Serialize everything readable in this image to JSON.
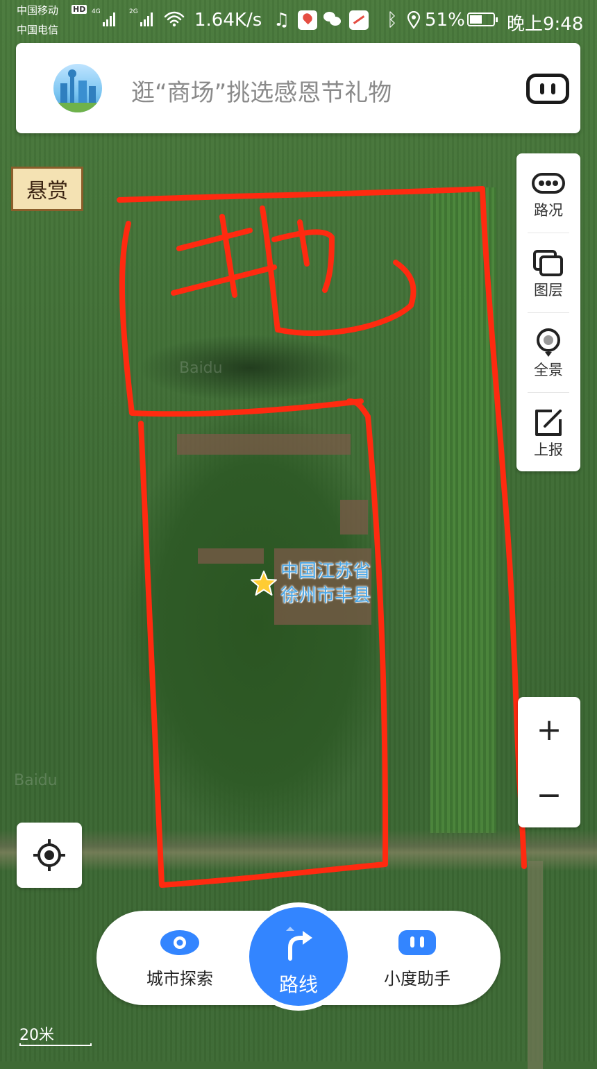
{
  "status_bar": {
    "carrier1": "中国移动",
    "carrier2": "中国电信",
    "hd_badge": "HD",
    "net1": "4G",
    "net2": "2G",
    "speed": "1.64K/s",
    "battery": "51%",
    "time": "晚上9:48"
  },
  "search": {
    "placeholder": "逛“商场”挑选感恩节礼物"
  },
  "reward_banner": "悬赏",
  "toolbar": {
    "items": [
      {
        "label": "路况",
        "icon": "traffic-icon"
      },
      {
        "label": "图层",
        "icon": "layers-icon"
      },
      {
        "label": "全景",
        "icon": "panorama-icon"
      },
      {
        "label": "上报",
        "icon": "report-icon"
      }
    ]
  },
  "zoom": {
    "in": "+",
    "out": "−"
  },
  "map": {
    "pin_label_line1": "中国江苏省",
    "pin_label_line2": "徐州市丰县",
    "annotation_text": "地",
    "watermark": "Baidu",
    "scale": "20米"
  },
  "bottom_nav": {
    "explore": "城市探索",
    "route": "路线",
    "assistant": "小度助手"
  },
  "colors": {
    "accent": "#3385ff",
    "annotation": "#ff2a10",
    "pin": "#ffcc33"
  }
}
